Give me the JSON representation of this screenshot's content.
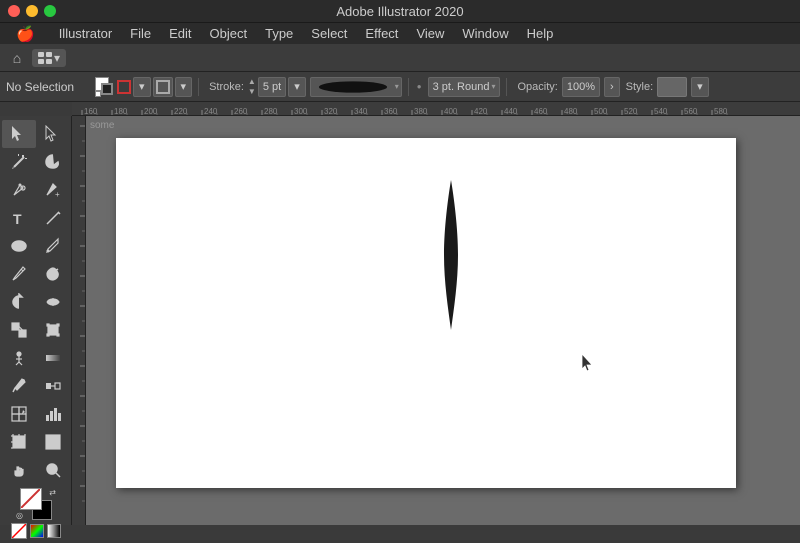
{
  "titleBar": {
    "title": "Adobe Illustrator 2020",
    "trafficLights": [
      "close",
      "minimize",
      "maximize"
    ]
  },
  "menuBar": {
    "items": [
      "🍎",
      "Illustrator",
      "File",
      "Edit",
      "Object",
      "Type",
      "Select",
      "Effect",
      "View",
      "Window",
      "Help"
    ]
  },
  "appToolbar": {
    "homeIcon": "⌂",
    "workspaceLabel": "⊞",
    "workspaceChevron": "▾"
  },
  "controlBar": {
    "noSelectionLabel": "No Selection",
    "strokeLabel": "Stroke:",
    "strokeValue": "5 pt",
    "variableWidthLabel": "3 pt. Round",
    "opacityLabel": "Opacity:",
    "opacityValue": "100%",
    "styleLabel": "Style:"
  },
  "ruler": {
    "ticks": [
      "160",
      "180",
      "200",
      "220",
      "240",
      "260",
      "280",
      "300",
      "320",
      "340",
      "360",
      "380",
      "400",
      "420",
      "440",
      "460",
      "480",
      "500",
      "520",
      "540",
      "560",
      "580"
    ]
  },
  "toolbox": {
    "tools": [
      {
        "name": "selection",
        "icon": "selection"
      },
      {
        "name": "direct-selection",
        "icon": "direct-selection"
      },
      {
        "name": "magic-wand",
        "icon": "magic-wand"
      },
      {
        "name": "lasso",
        "icon": "lasso"
      },
      {
        "name": "pen",
        "icon": "pen"
      },
      {
        "name": "add-anchor",
        "icon": "add-anchor"
      },
      {
        "name": "type",
        "icon": "type"
      },
      {
        "name": "line",
        "icon": "line"
      },
      {
        "name": "ellipse",
        "icon": "ellipse"
      },
      {
        "name": "paintbrush",
        "icon": "paintbrush"
      },
      {
        "name": "pencil",
        "icon": "pencil"
      },
      {
        "name": "shaper",
        "icon": "shaper"
      },
      {
        "name": "rotate",
        "icon": "rotate"
      },
      {
        "name": "warp",
        "icon": "warp"
      },
      {
        "name": "scale",
        "icon": "scale"
      },
      {
        "name": "free-transform",
        "icon": "free-transform"
      },
      {
        "name": "puppet-warp",
        "icon": "puppet-warp"
      },
      {
        "name": "gradient",
        "icon": "gradient"
      },
      {
        "name": "eyedropper",
        "icon": "eyedropper"
      },
      {
        "name": "blend",
        "icon": "blend"
      },
      {
        "name": "live-paint",
        "icon": "live-paint"
      },
      {
        "name": "column-graph",
        "icon": "column-graph"
      },
      {
        "name": "artboard",
        "icon": "artboard"
      },
      {
        "name": "slice",
        "icon": "slice"
      },
      {
        "name": "hand",
        "icon": "hand"
      },
      {
        "name": "zoom",
        "icon": "zoom"
      },
      {
        "name": "color",
        "icon": "color"
      }
    ]
  },
  "canvas": {
    "label": "some",
    "artboardLabel": "some"
  },
  "colors": {
    "background": "#6b6b6b",
    "toolbar": "#3c3c3c",
    "titlebar": "#2b2b2b",
    "artboard": "#ffffff",
    "accent": "#ff5f57"
  }
}
